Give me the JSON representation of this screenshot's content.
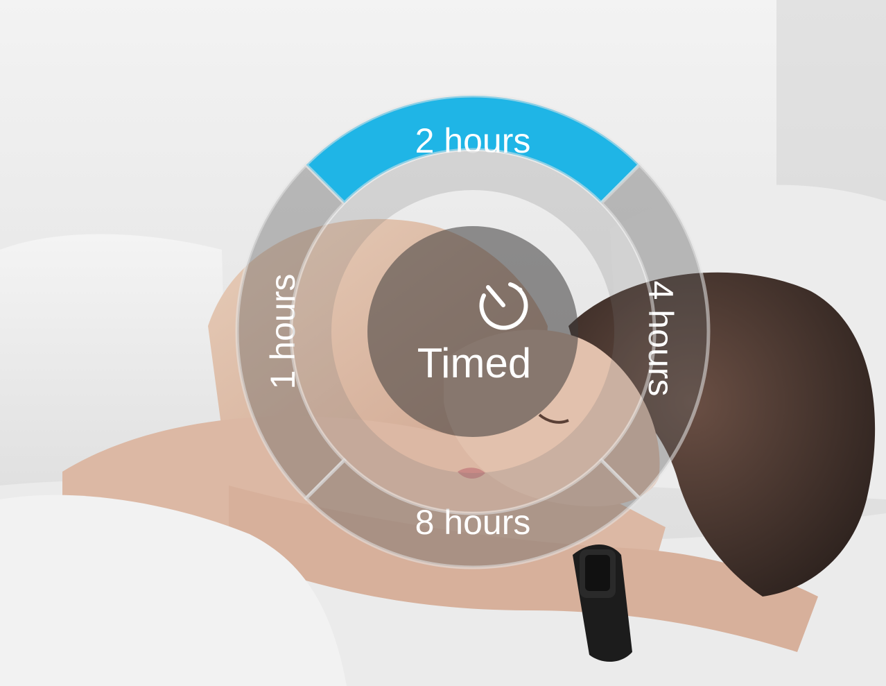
{
  "timer_wheel": {
    "selected_index": 1,
    "selected_color": "#1fb5e6",
    "options": [
      {
        "label": "1 hours",
        "selected": false
      },
      {
        "label": "2 hours",
        "selected": true
      },
      {
        "label": "4 hours",
        "selected": false
      },
      {
        "label": "8 hours",
        "selected": false
      }
    ],
    "center": {
      "icon": "timer-icon",
      "label": "Timed"
    }
  },
  "photo": {
    "description_icon": "photo-background",
    "wristband_icon": "fitness-band-icon"
  }
}
